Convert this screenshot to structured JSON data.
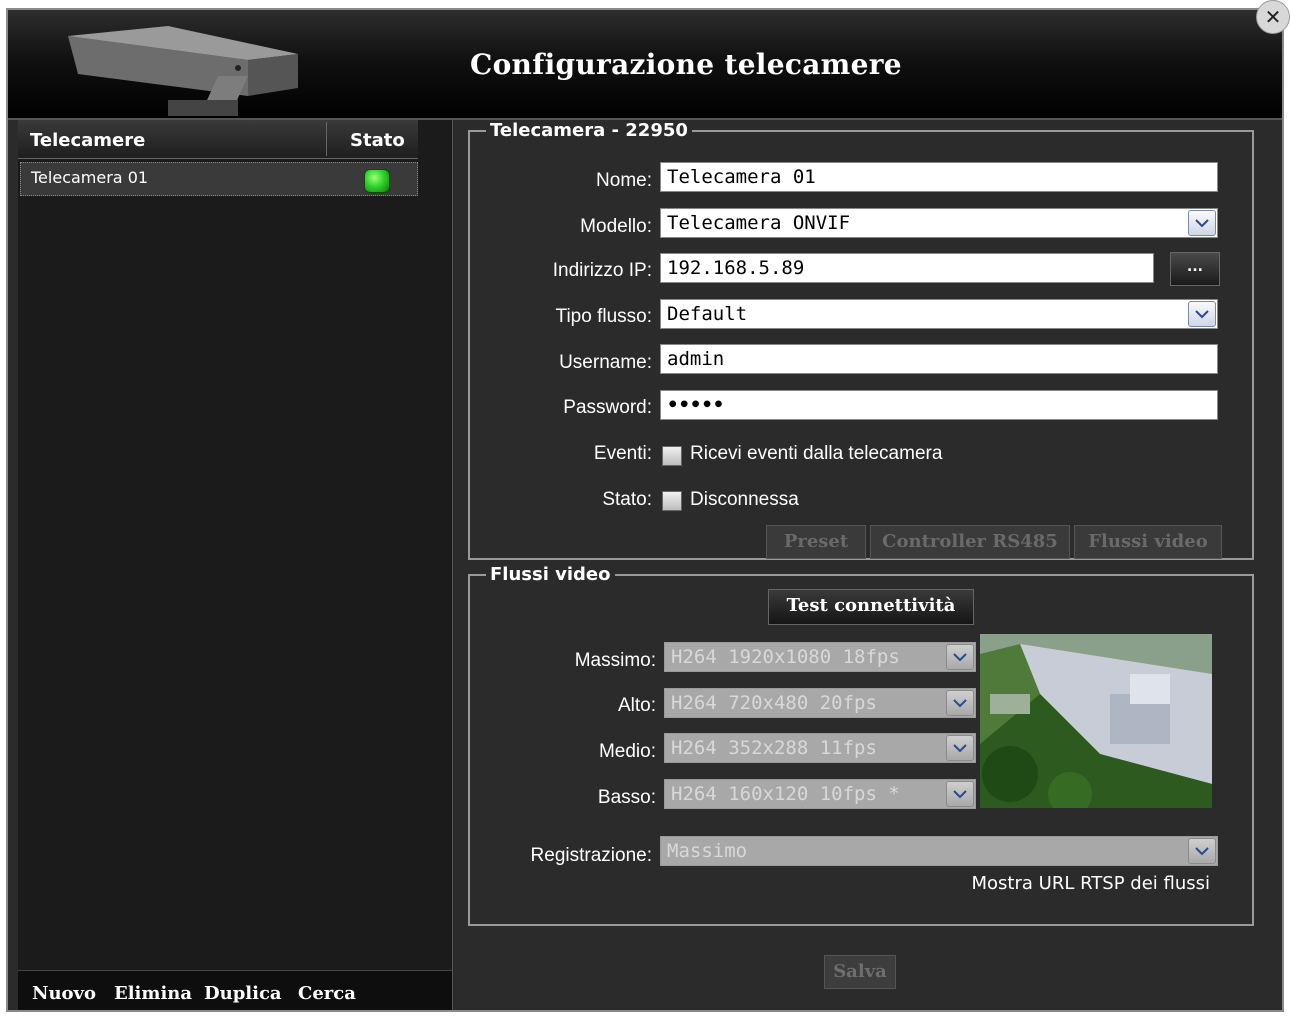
{
  "window": {
    "title": "Configurazione telecamere"
  },
  "camera_list": {
    "headers": {
      "name": "Telecamere",
      "status": "Stato"
    },
    "rows": [
      {
        "label": "Telecamera 01",
        "status": "online"
      }
    ],
    "footer": [
      "Nuovo",
      "Elimina",
      "Duplica",
      "Cerca"
    ]
  },
  "camera_form": {
    "legend": "Telecamera - 22950",
    "fields": {
      "nome": {
        "label": "Nome:",
        "value": "Telecamera 01"
      },
      "modello": {
        "label": "Modello:",
        "value": "Telecamera ONVIF"
      },
      "ip": {
        "label": "Indirizzo IP:",
        "value": "192.168.5.89"
      },
      "tipo_flusso": {
        "label": "Tipo flusso:",
        "value": "Default"
      },
      "username": {
        "label": "Username:",
        "value": "admin"
      },
      "password": {
        "label": "Password:",
        "value": "•••••"
      },
      "eventi": {
        "label": "Eventi:",
        "checkbox_label": "Ricevi eventi dalla telecamera",
        "checked": false
      },
      "stato": {
        "label": "Stato:",
        "checkbox_label": "Disconnessa",
        "checked": false
      }
    },
    "ip_browse_label": "...",
    "tab_buttons": [
      "Preset",
      "Controller RS485",
      "Flussi video"
    ]
  },
  "flussi": {
    "legend": "Flussi video",
    "test_button": "Test connettività",
    "streams": [
      {
        "label": "Massimo:",
        "value": "H264 1920x1080 18fps"
      },
      {
        "label": "Alto:",
        "value": "H264 720x480 20fps"
      },
      {
        "label": "Medio:",
        "value": "H264 352x288 11fps"
      },
      {
        "label": "Basso:",
        "value": "H264 160x120 10fps *"
      }
    ],
    "registrazione": {
      "label": "Registrazione:",
      "value": "Massimo"
    },
    "rtsp_link": "Mostra URL RTSP dei flussi"
  },
  "save_button": "Salva",
  "colors": {
    "status_ok": "#2fd42a",
    "background": "#2b2b2b",
    "panel": "#1b1b1b"
  }
}
